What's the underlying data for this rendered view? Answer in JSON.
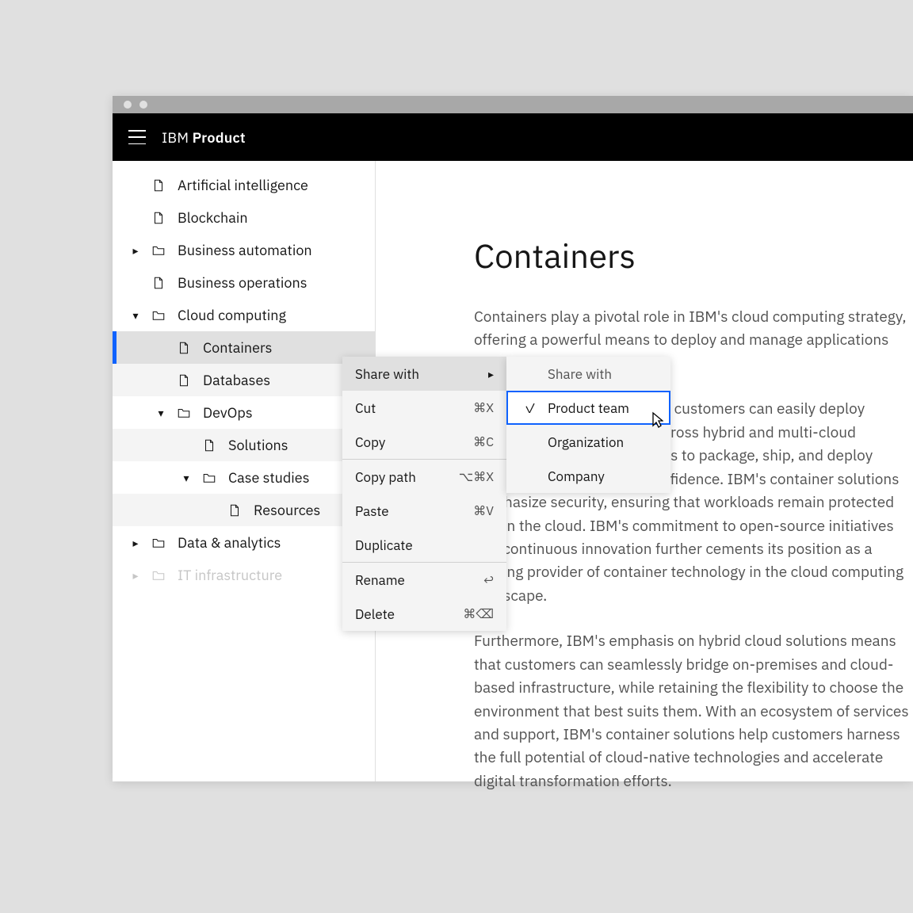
{
  "header": {
    "brand_light": "IBM ",
    "brand_bold": "Product"
  },
  "sidebar": {
    "items": [
      {
        "label": "Artificial intelligence",
        "type": "doc",
        "level": 1
      },
      {
        "label": "Blockchain",
        "type": "doc",
        "level": 1
      },
      {
        "label": "Business automation",
        "type": "folder",
        "level": 1,
        "caret": "right"
      },
      {
        "label": "Business operations",
        "type": "doc",
        "level": 1
      },
      {
        "label": "Cloud computing",
        "type": "folder",
        "level": 1,
        "caret": "down"
      },
      {
        "label": "Containers",
        "type": "doc",
        "level": 2,
        "selected": true
      },
      {
        "label": "Databases",
        "type": "doc",
        "level": 2,
        "alt": true
      },
      {
        "label": "DevOps",
        "type": "folder",
        "level": 2,
        "caret": "down"
      },
      {
        "label": "Solutions",
        "type": "doc",
        "level": 3,
        "alt": true
      },
      {
        "label": "Case studies",
        "type": "folder",
        "level": 3,
        "caret": "down"
      },
      {
        "label": "Resources",
        "type": "doc",
        "level": 4,
        "alt": true
      },
      {
        "label": "Data & analytics",
        "type": "folder",
        "level": 1,
        "caret": "right"
      },
      {
        "label": "IT infrastructure",
        "type": "folder",
        "level": 1,
        "caret": "right",
        "disabled": true
      }
    ]
  },
  "main": {
    "title": "Containers",
    "para1": "Containers play a pivotal role in IBM's cloud computing strategy, offering a powerful means to deploy and manage applications with remarkable flexibility.",
    "para2": "With IBM's container service, customers can easily deploy containerized applications across hybrid and multi-cloud environments, enabling teams to package, ship, and deploy applications rapidly, with confidence. IBM's container solutions emphasize security, ensuring that workloads remain protected within the cloud. IBM's commitment to open-source initiatives and continuous innovation further cements its position as a leading provider of container technology in the cloud computing landscape.",
    "para3": "Furthermore, IBM's emphasis on hybrid cloud solutions means that customers can seamlessly bridge on-premises and cloud-based infrastructure, while retaining the flexibility to choose the environment that best suits them. With an ecosystem of services and support, IBM's container solutions help customers harness the full potential of cloud-native technologies and accelerate digital transformation efforts."
  },
  "context_menu": {
    "items": [
      {
        "label": "Share with",
        "shortcut": "",
        "sub": true,
        "hover": true
      },
      {
        "label": "Cut",
        "shortcut": "⌘X"
      },
      {
        "label": "Copy",
        "shortcut": "⌘C"
      },
      {
        "sep": true
      },
      {
        "label": "Copy path",
        "shortcut": "⌥⌘X"
      },
      {
        "label": "Paste",
        "shortcut": "⌘V"
      },
      {
        "label": "Duplicate",
        "shortcut": ""
      },
      {
        "sep": true
      },
      {
        "label": "Rename",
        "shortcut": "↩"
      },
      {
        "label": "Delete",
        "shortcut": "⌘⌫"
      }
    ]
  },
  "submenu": {
    "title": "Share with",
    "items": [
      {
        "label": "Product team",
        "checked": true,
        "selected": true
      },
      {
        "label": "Organization"
      },
      {
        "label": "Company"
      }
    ]
  }
}
